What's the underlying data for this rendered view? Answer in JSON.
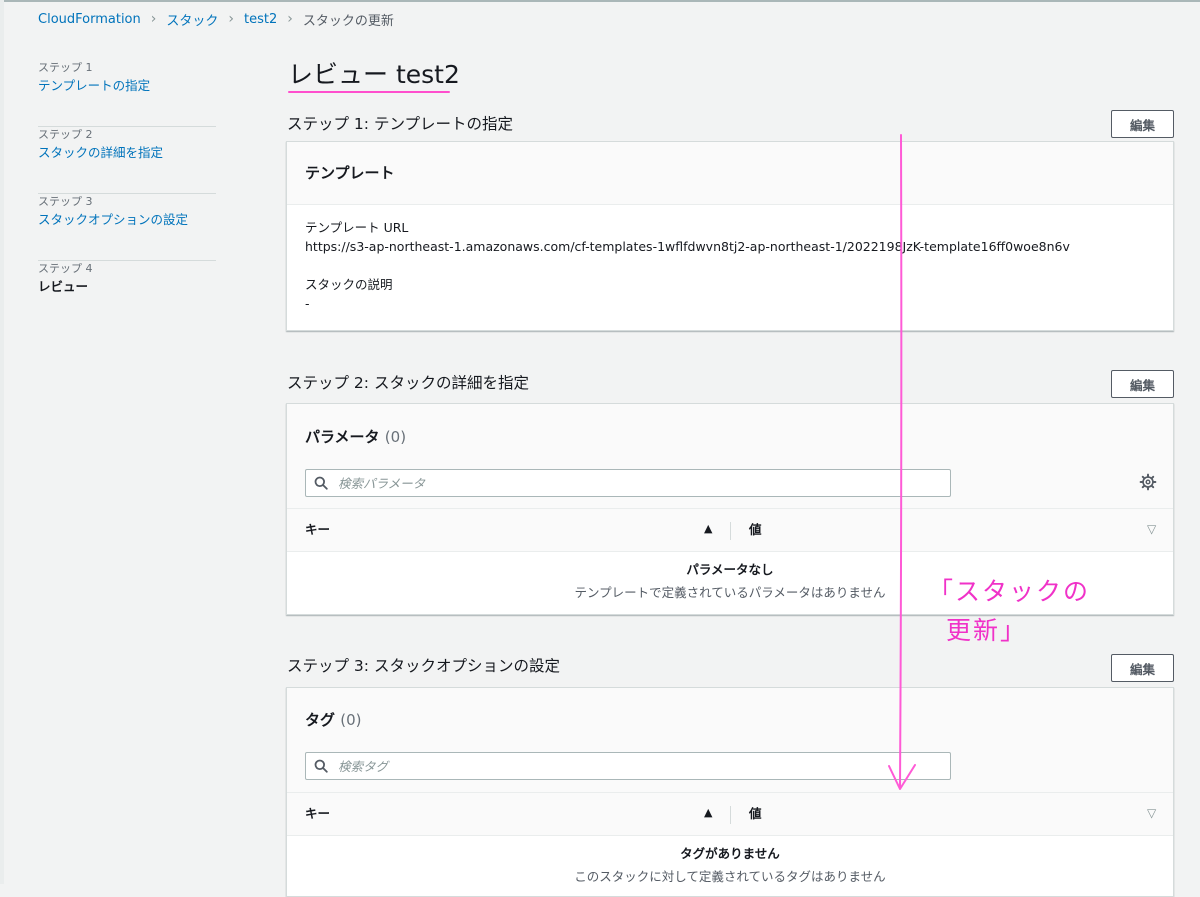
{
  "breadcrumb": {
    "items": [
      "CloudFormation",
      "スタック",
      "test2"
    ],
    "current": "スタックの更新"
  },
  "nav": [
    {
      "step": "ステップ 1",
      "label": "テンプレートの指定"
    },
    {
      "step": "ステップ 2",
      "label": "スタックの詳細を指定"
    },
    {
      "step": "ステップ 3",
      "label": "スタックオプションの設定"
    },
    {
      "step": "ステップ 4",
      "label": "レビュー"
    }
  ],
  "page_title": "レビュー test2",
  "edit_label": "編集",
  "step1": {
    "heading": "ステップ 1: テンプレートの指定",
    "panel_title": "テンプレート",
    "url_key": "テンプレート URL",
    "url_value": "https://s3-ap-northeast-1.amazonaws.com/cf-templates-1wflfdwvn8tj2-ap-northeast-1/2022198JzK-template16ff0woe8n6v",
    "desc_key": "スタックの説明",
    "desc_value": "-"
  },
  "step2": {
    "heading": "ステップ 2: スタックの詳細を指定",
    "panel_title": "パラメータ",
    "count": "(0)",
    "search_placeholder": "検索パラメータ",
    "col_key": "キー",
    "col_value": "値",
    "empty_title": "パラメータなし",
    "empty_desc": "テンプレートで定義されているパラメータはありません"
  },
  "step3": {
    "heading": "ステップ 3: スタックオプションの設定",
    "panel_title": "タグ",
    "count": "(0)",
    "search_placeholder": "検索タグ",
    "col_key": "キー",
    "col_value": "値",
    "empty_title": "タグがありません",
    "empty_desc": "このスタックに対して定義されているタグはありません"
  },
  "annotation": {
    "line1": "「スタックの",
    "line2": "更新」",
    "color": "#f032c8"
  },
  "colors": {
    "link": "#0073bb",
    "annotation": "#ff4ecd",
    "background": "#f2f3f3"
  },
  "icons": [
    "chevron-right-icon",
    "search-icon",
    "gear-icon",
    "sort-ascending-icon",
    "sort-descending-icon"
  ]
}
